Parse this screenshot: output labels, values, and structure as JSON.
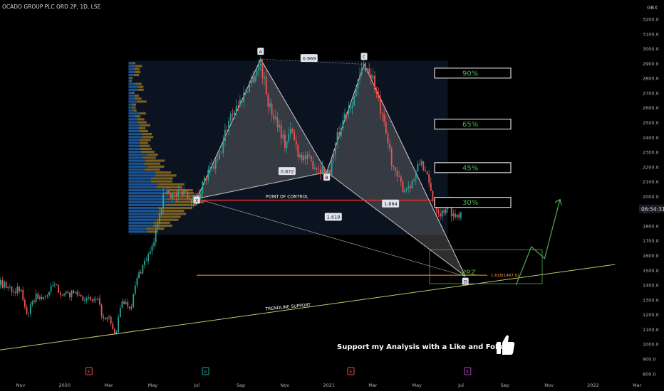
{
  "symbol_title": "OCADO GROUP PLC ORD 2P, 1D, LSE",
  "currency": "GBX",
  "price_tag": "06:54:31",
  "colors": {
    "background": "#000000",
    "up": "#26a69a",
    "down": "#ef5350",
    "pattern_fill": "#8f8f8f",
    "poc_line": "#ff2a2a",
    "green_text": "#4caf50",
    "fib_line": "#f59d2a",
    "trend_line": "#c9c26a",
    "arrow": "#4caf50",
    "volume_up": "#1f5fa8",
    "volume_down": "#8c6d24"
  },
  "chart_data": {
    "type": "candlestick",
    "title": "OCADO GROUP PLC ORD 2P, 1D, LSE",
    "ylabel": "GBX",
    "ylim": [
      770,
      3330
    ],
    "y_ticks": [
      800,
      900,
      1000,
      1100,
      1200,
      1300,
      1400,
      1500,
      1600,
      1700,
      1800,
      1900,
      2000,
      2100,
      2200,
      2300,
      2400,
      2500,
      2600,
      2700,
      2800,
      2900,
      3000,
      3100,
      3200
    ],
    "y_tick_labels": [
      "800.0",
      "900.0",
      "1000.0",
      "1100.0",
      "1200.0",
      "1300.0",
      "1400.0",
      "1500.0",
      "1600.0",
      "1700.0",
      "1800.0",
      "1900.0",
      "2000.0",
      "2100.0",
      "2200.0",
      "2300.0",
      "2400.0",
      "2500.0",
      "2600.0",
      "2700.0",
      "2800.0",
      "2900.0",
      "3000.0",
      "3100.0",
      "3200.0"
    ],
    "x_ticks": [
      "Nov",
      "2020",
      "Mar",
      "May",
      "Jul",
      "Sep",
      "Nov",
      "2021",
      "Mar",
      "May",
      "Jul",
      "Sep",
      "Nov",
      "2022",
      "Mar"
    ],
    "x_tick_pos": [
      0.0,
      2.0,
      4.0,
      6.0,
      8.0,
      10.0,
      12.0,
      14.0,
      16.0,
      18.0,
      20.0,
      22.0,
      24.0,
      26.0,
      28.0
    ],
    "price_path": [
      [
        -1.0,
        1420
      ],
      [
        -0.5,
        1380
      ],
      [
        0.0,
        1360
      ],
      [
        0.3,
        1200
      ],
      [
        0.7,
        1330
      ],
      [
        1.0,
        1300
      ],
      [
        1.5,
        1400
      ],
      [
        2.0,
        1330
      ],
      [
        2.5,
        1350
      ],
      [
        3.0,
        1300
      ],
      [
        3.5,
        1290
      ],
      [
        3.8,
        1150
      ],
      [
        4.0,
        1180
      ],
      [
        4.3,
        1050
      ],
      [
        4.6,
        1300
      ],
      [
        5.0,
        1250
      ],
      [
        5.3,
        1450
      ],
      [
        5.6,
        1550
      ],
      [
        6.0,
        1650
      ],
      [
        6.3,
        1900
      ],
      [
        6.6,
        2050
      ],
      [
        7.0,
        2000
      ],
      [
        7.4,
        2050
      ],
      [
        7.8,
        1980
      ],
      [
        8.0,
        2000
      ],
      [
        8.5,
        2150
      ],
      [
        9.0,
        2250
      ],
      [
        9.5,
        2550
      ],
      [
        10.0,
        2650
      ],
      [
        10.5,
        2800
      ],
      [
        10.9,
        2900
      ],
      [
        11.3,
        2600
      ],
      [
        11.7,
        2500
      ],
      [
        12.0,
        2350
      ],
      [
        12.3,
        2450
      ],
      [
        12.6,
        2300
      ],
      [
        13.0,
        2250
      ],
      [
        13.5,
        2200
      ],
      [
        14.0,
        2150
      ],
      [
        14.3,
        2350
      ],
      [
        14.7,
        2550
      ],
      [
        15.2,
        2700
      ],
      [
        15.6,
        2900
      ],
      [
        16.0,
        2800
      ],
      [
        16.3,
        2600
      ],
      [
        16.7,
        2350
      ],
      [
        17.0,
        2150
      ],
      [
        17.4,
        2050
      ],
      [
        17.8,
        2100
      ],
      [
        18.2,
        2250
      ],
      [
        18.5,
        2100
      ],
      [
        18.8,
        1950
      ],
      [
        19.1,
        1880
      ],
      [
        19.4,
        1950
      ],
      [
        19.7,
        1860
      ],
      [
        20.0,
        1900
      ]
    ],
    "annotations": {
      "points": [
        {
          "label": "X",
          "x": 8.0,
          "y": 1985
        },
        {
          "label": "A",
          "x": 10.9,
          "y": 2930
        },
        {
          "label": "B",
          "x": 13.9,
          "y": 2165
        },
        {
          "label": "C",
          "x": 15.6,
          "y": 2895
        },
        {
          "label": "D",
          "x": 20.2,
          "y": 1460
        }
      ],
      "ratios": [
        {
          "label": "0.969",
          "x": 13.1,
          "y": 2935
        },
        {
          "label": "0.872",
          "x": 12.1,
          "y": 2170
        },
        {
          "label": "1.618",
          "x": 14.2,
          "y": 1860
        },
        {
          "label": "1.884",
          "x": 16.8,
          "y": 1950
        }
      ],
      "fib_levels": [
        {
          "label": "90%",
          "y": 2835
        },
        {
          "label": "65%",
          "y": 2490
        },
        {
          "label": "45%",
          "y": 2195
        },
        {
          "label": "30%",
          "y": 1960
        }
      ],
      "poc_label": "POINT OF CONTROL",
      "poc_value": 1975,
      "prz_label": "PRZ",
      "prz_range": [
        1410,
        1640
      ],
      "fib_ext_label": "1.618(1467.0)",
      "fib_ext_value": 1467,
      "trendline_label": "TRENDLINE SUPPORT",
      "trendline": [
        [
          -1.0,
          960
        ],
        [
          27.0,
          1540
        ]
      ],
      "projection": [
        [
          22.5,
          1400
        ],
        [
          23.2,
          1660
        ],
        [
          23.8,
          1580
        ],
        [
          24.5,
          1980
        ]
      ]
    },
    "event_markers": [
      {
        "x": 3.1,
        "label": "E",
        "kind": "earnings"
      },
      {
        "x": 8.4,
        "label": "E",
        "kind": "earnings-good"
      },
      {
        "x": 15.0,
        "label": "E",
        "kind": "earnings"
      },
      {
        "x": 20.3,
        "label": "E",
        "kind": "earnings-next"
      }
    ]
  },
  "footer_text": "Support my Analysis with a Like and Follow",
  "icons": {
    "thumb": "thumbs-up-icon"
  }
}
